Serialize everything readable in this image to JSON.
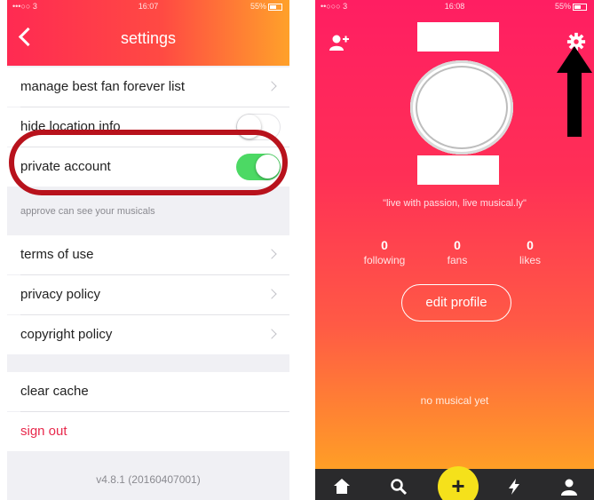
{
  "left": {
    "status": {
      "carrier": "•••○○ 3",
      "time": "16:07",
      "battery": "55%"
    },
    "header": {
      "title": "settings"
    },
    "rows": {
      "manage_best_fan": "manage best fan forever list",
      "hide_location": "hide location info",
      "private_account": "private account",
      "private_caption": "approve can see your musicals",
      "terms": "terms of use",
      "privacy": "privacy policy",
      "copyright": "copyright policy",
      "clear_cache": "clear cache",
      "sign_out": "sign out"
    },
    "toggles": {
      "hide_location": false,
      "private_account": true
    },
    "version": "v4.8.1 (20160407001)"
  },
  "right": {
    "status": {
      "carrier": "••○○○ 3",
      "time": "16:08",
      "battery": "55%"
    },
    "bio": "\"live with passion, live musical.ly\"",
    "stats": [
      {
        "value": "0",
        "label": "following"
      },
      {
        "value": "0",
        "label": "fans"
      },
      {
        "value": "0",
        "label": "likes"
      }
    ],
    "edit_profile": "edit profile",
    "empty_message": "no musical yet",
    "plus": "+"
  },
  "colors": {
    "header_gradient_start": "#ff2a52",
    "header_gradient_end": "#ffa12a",
    "toggle_on": "#4cd964",
    "highlight_ring": "#b8121c",
    "sign_out": "#e8294c",
    "plus_button": "#f5e11b",
    "tabbar": "#2a2a2c"
  },
  "icons": [
    "back-icon",
    "chevron-right-icon",
    "add-user-icon",
    "gear-icon",
    "arrow-up-icon",
    "home-icon",
    "search-icon",
    "plus-icon",
    "lightning-icon",
    "profile-icon"
  ]
}
